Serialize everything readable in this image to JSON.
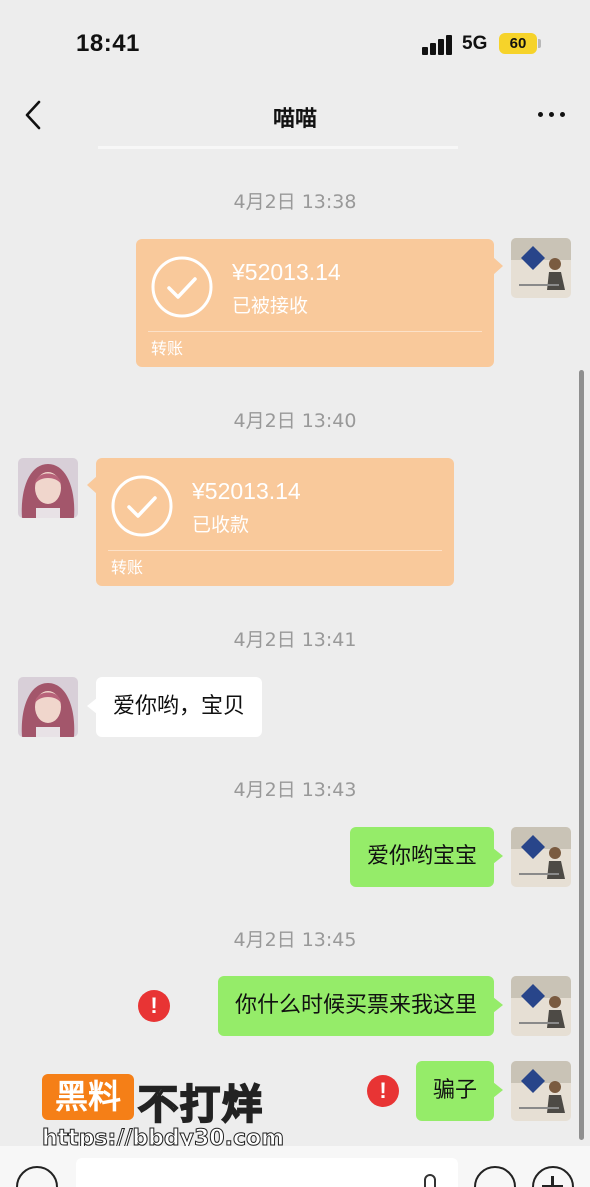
{
  "status_bar": {
    "time": "18:41",
    "network": "5G",
    "battery": "60"
  },
  "nav": {
    "title": "喵喵",
    "back_icon": "chevron-left-icon",
    "more_icon": "more-dots-icon"
  },
  "messages": [
    {
      "type": "timestamp",
      "text": "4月2日 13:38"
    },
    {
      "type": "transfer",
      "side": "right",
      "amount": "¥52013.14",
      "status": "已被接收",
      "kind": "转账"
    },
    {
      "type": "timestamp",
      "text": "4月2日 13:40"
    },
    {
      "type": "transfer",
      "side": "left",
      "amount": "¥52013.14",
      "status": "已收款",
      "kind": "转账"
    },
    {
      "type": "timestamp",
      "text": "4月2日 13:41"
    },
    {
      "type": "text",
      "side": "left",
      "text": "爱你哟，宝贝"
    },
    {
      "type": "timestamp",
      "text": "4月2日 13:43"
    },
    {
      "type": "text",
      "side": "right",
      "text": "爱你哟宝宝"
    },
    {
      "type": "timestamp",
      "text": "4月2日 13:45"
    },
    {
      "type": "text",
      "side": "right",
      "text": "你什么时候买票来我这里",
      "failed": true
    },
    {
      "type": "text",
      "side": "right",
      "text": "骗子",
      "failed": true
    }
  ],
  "error_mark": "!",
  "watermark": {
    "logo": "黑料",
    "text": "不打烊",
    "url": "https://bbdy30.com"
  },
  "colors": {
    "background": "#ededed",
    "transfer": "#f9c99b",
    "sent_bubble": "#95ec69",
    "error": "#e83434"
  }
}
